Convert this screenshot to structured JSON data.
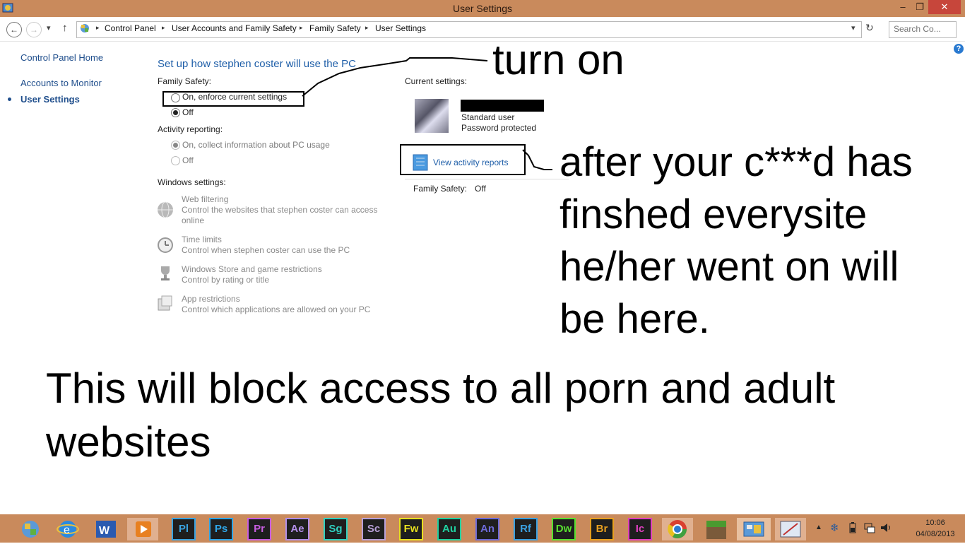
{
  "window": {
    "title": "User Settings",
    "minimize_glyph": "–",
    "maximize_glyph": "❐",
    "close_glyph": "✕"
  },
  "address_bar": {
    "back_glyph": "←",
    "forward_glyph": "→",
    "dropdown_glyph": "▾",
    "up_glyph": "↑",
    "refresh_glyph": "↻",
    "breadcrumbs": [
      "Control Panel",
      "User Accounts and Family Safety",
      "Family Safety",
      "User Settings"
    ],
    "search_placeholder": "Search Co..."
  },
  "help_glyph": "?",
  "left_nav": {
    "items": [
      {
        "label": "Control Panel Home",
        "active": false
      },
      {
        "label": "Accounts to Monitor",
        "active": false
      },
      {
        "label": "User Settings",
        "active": true
      }
    ]
  },
  "main": {
    "heading": "Set up how stephen coster will use the PC",
    "family_safety": {
      "label": "Family Safety:",
      "options": [
        "On, enforce current settings",
        "Off"
      ],
      "selected": "Off"
    },
    "activity_reporting": {
      "label": "Activity reporting:",
      "options": [
        "On, collect information about PC usage",
        "Off"
      ],
      "selected": "On, collect information about PC usage"
    },
    "windows_settings": {
      "label": "Windows settings:",
      "items": [
        {
          "title": "Web filtering",
          "desc": "Control the websites that stephen coster can access online",
          "icon": "globe-icon"
        },
        {
          "title": "Time limits",
          "desc": "Control when stephen coster can use the PC",
          "icon": "clock-icon"
        },
        {
          "title": "Windows Store and game restrictions",
          "desc": "Control by rating or title",
          "icon": "trophy-icon"
        },
        {
          "title": "App restrictions",
          "desc": "Control which applications are allowed on your PC",
          "icon": "app-icon"
        }
      ]
    }
  },
  "current_settings": {
    "label": "Current settings:",
    "account_type": "Standard user",
    "password": "Password protected",
    "view_reports": "View activity reports",
    "family_safety_label": "Family Safety:",
    "family_safety_value": "Off"
  },
  "annotations": {
    "turn_on": "turn on",
    "after": [
      "after your c***d has",
      "finshed everysite",
      "he/her went on will",
      "be here."
    ],
    "bottom": [
      "This will block access to all porn and adult",
      "websites"
    ]
  },
  "taskbar": {
    "apps": [
      {
        "label": "Pl",
        "color": "#3aa3e0"
      },
      {
        "label": "Ps",
        "color": "#2fa6e8"
      },
      {
        "label": "Pr",
        "color": "#c85ee0"
      },
      {
        "label": "Ae",
        "color": "#b28ee8"
      },
      {
        "label": "Sg",
        "color": "#2fd0c0"
      },
      {
        "label": "Sc",
        "color": "#b8a0d8"
      },
      {
        "label": "Fw",
        "color": "#e8e020"
      },
      {
        "label": "Au",
        "color": "#20d0a0"
      },
      {
        "label": "An",
        "color": "#6d6ad8"
      },
      {
        "label": "Rf",
        "color": "#3aa0e0"
      },
      {
        "label": "Dw",
        "color": "#58e030"
      },
      {
        "label": "Br",
        "color": "#e8a020"
      },
      {
        "label": "Ic",
        "color": "#e040c0"
      }
    ],
    "time": "10:06",
    "date": "04/08/2013"
  }
}
